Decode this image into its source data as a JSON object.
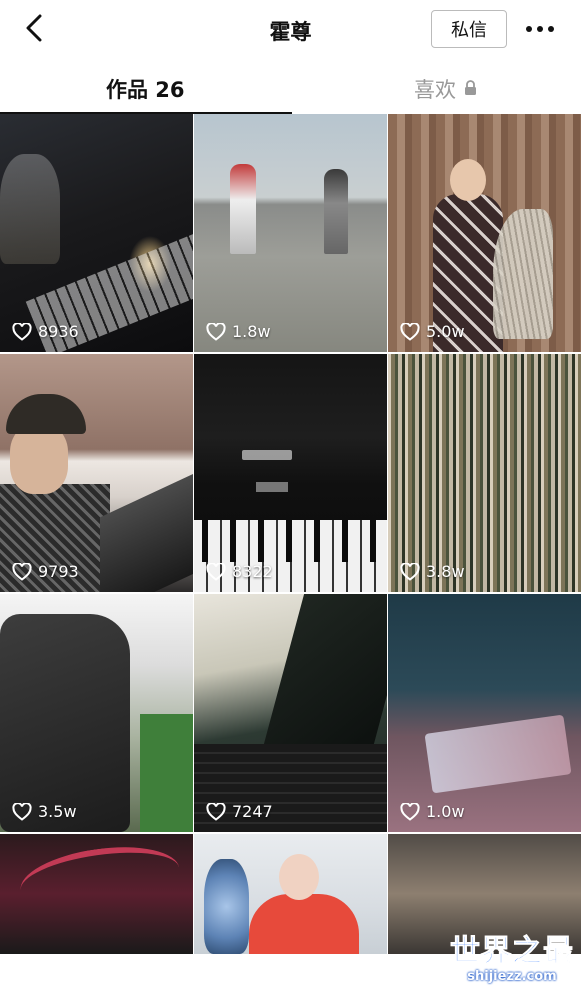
{
  "header": {
    "title": "霍尊",
    "message_button": "私信",
    "back_icon": "chevron-left-icon",
    "more_icon": "more-dots-icon"
  },
  "tabs": {
    "works_label": "作品 26",
    "likes_label": "喜欢",
    "likes_lock_icon": "lock-icon"
  },
  "videos": [
    {
      "likes": "8936"
    },
    {
      "likes": "1.8w"
    },
    {
      "likes": "5.0w"
    },
    {
      "likes": "9793"
    },
    {
      "likes": "8322"
    },
    {
      "likes": "3.8w"
    },
    {
      "likes": "3.5w"
    },
    {
      "likes": "7247"
    },
    {
      "likes": "1.0w"
    }
  ],
  "watermark": {
    "main": "世界之最",
    "sub": "shijiezz.com"
  },
  "colors": {
    "text_primary": "#111111",
    "text_secondary": "#999999",
    "watermark_blue": "#2e78ff"
  }
}
